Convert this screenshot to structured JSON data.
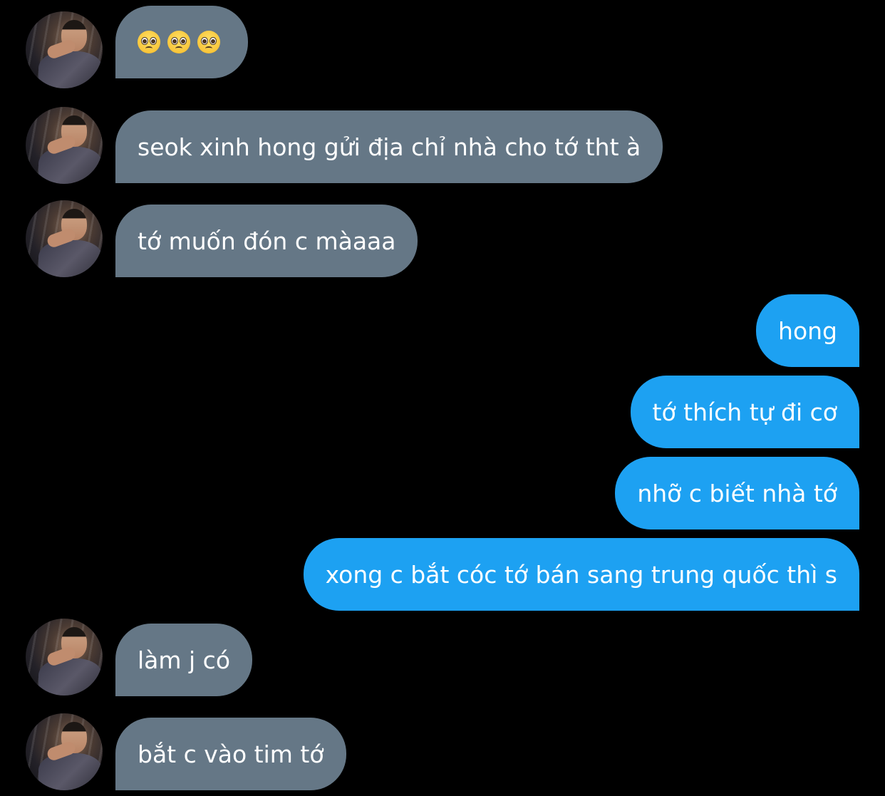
{
  "chat": {
    "messages": [
      {
        "sender": "other",
        "text": "🥺🥺🥺"
      },
      {
        "sender": "other",
        "text": "seok xinh hong gửi địa chỉ nhà cho tớ tht à"
      },
      {
        "sender": "other",
        "text": "tớ muốn đón c màaaa"
      },
      {
        "sender": "me",
        "text": "hong"
      },
      {
        "sender": "me",
        "text": "tớ thích tự đi cơ"
      },
      {
        "sender": "me",
        "text": "nhỡ c biết nhà tớ"
      },
      {
        "sender": "me",
        "text": "xong c bắt cóc tớ bán sang trung quốc thì s"
      },
      {
        "sender": "other",
        "text": "làm j có"
      },
      {
        "sender": "other",
        "text": "bắt c vào tim tớ"
      }
    ]
  },
  "colors": {
    "background": "#000000",
    "incoming_bubble": "#657786",
    "outgoing_bubble": "#1da1f2",
    "text": "#ffffff"
  },
  "icons": {
    "emoji": "pleading-face-emoji"
  }
}
